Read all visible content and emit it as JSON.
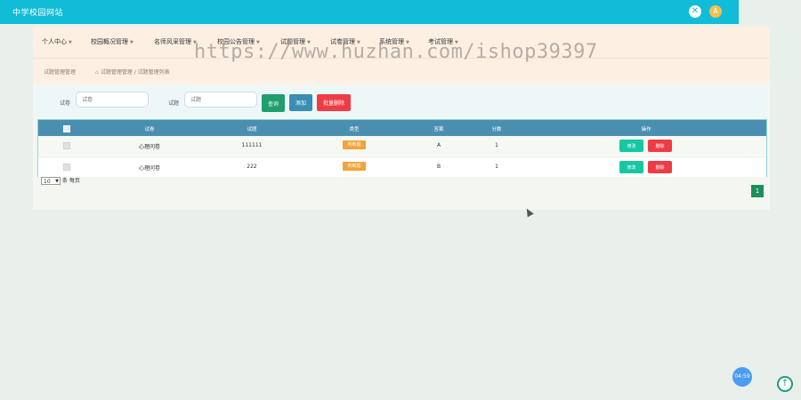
{
  "app": {
    "title": "中学校园网站",
    "avatar_letter": "A"
  },
  "nav": {
    "items": [
      {
        "label": "个人中心"
      },
      {
        "label": "校园概况管理"
      },
      {
        "label": "名师风采管理"
      },
      {
        "label": "校园公告管理"
      },
      {
        "label": "试题管理"
      },
      {
        "label": "试卷管理"
      },
      {
        "label": "系统管理"
      },
      {
        "label": "考试管理"
      }
    ]
  },
  "breadcrumb": {
    "title": "试题管理管理",
    "path": "试题管理管理 / 试题管理列表"
  },
  "search": {
    "field1_label": "试卷",
    "field1_placeholder": "试卷",
    "field2_label": "试题",
    "field2_placeholder": "试题",
    "search_button": "查询",
    "add_button": "添加",
    "batch_delete_button": "批量删除"
  },
  "table": {
    "headers": [
      "试卷",
      "试题",
      "类型",
      "答案",
      "分数",
      "操作"
    ],
    "rows": [
      {
        "paper": "心理问卷",
        "question": "111111",
        "type": "判断题",
        "answer": "A",
        "score": "1",
        "edit": "修改",
        "delete": "删除"
      },
      {
        "paper": "心理问卷",
        "question": "222",
        "type": "判断题",
        "answer": "B",
        "score": "1",
        "edit": "修改",
        "delete": "删除"
      }
    ]
  },
  "pagination": {
    "page_size": "10",
    "per_page_label": "条 每页",
    "current_page": "1"
  },
  "watermark": "https://www.huzhan.com/ishop39397",
  "timer": "04:59",
  "colors": {
    "topbar": "#10bcd6",
    "nav_bg": "#fdf0e3",
    "table_header": "#4b8fb0",
    "delete": "#ef3b45",
    "edit": "#16c7a3",
    "badge": "#f4a23a"
  },
  "icons": {
    "close": "close-icon",
    "scroll_top": "arrow-up-icon",
    "home": "home-icon"
  }
}
